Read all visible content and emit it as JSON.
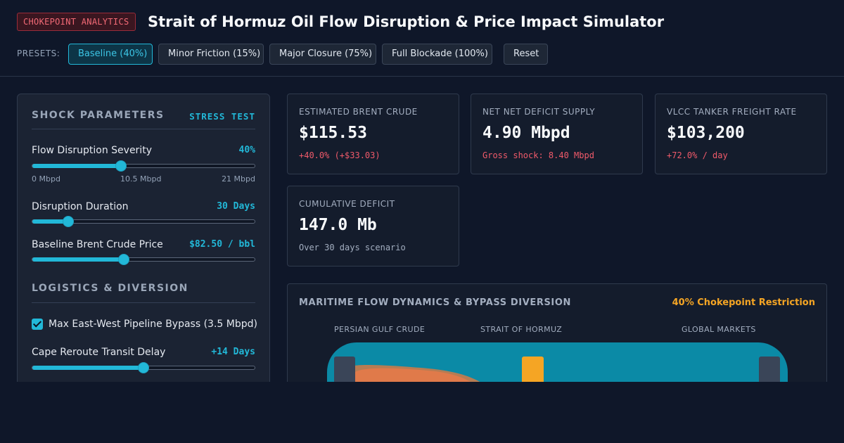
{
  "header": {
    "badge": "CHOKEPOINT ANALYTICS",
    "title": "Strait of Hormuz Oil Flow Disruption & Price Impact Simulator",
    "presets_label": "PRESETS:",
    "presets": [
      {
        "label": "Baseline (40%)",
        "active": true
      },
      {
        "label": "Minor Friction (15%)",
        "active": false
      },
      {
        "label": "Major Closure (75%)",
        "active": false
      },
      {
        "label": "Full Blockade (100%)",
        "active": false
      }
    ],
    "reset_label": "Reset"
  },
  "shock": {
    "title": "SHOCK PARAMETERS",
    "tag": "STRESS TEST",
    "severity": {
      "label": "Flow Disruption Severity",
      "value": "40%",
      "fraction": 0.4,
      "scale": [
        "0 Mbpd",
        "10.5 Mbpd",
        "21 Mbpd"
      ]
    },
    "duration": {
      "label": "Disruption Duration",
      "value": "30 Days",
      "fraction": 0.16
    },
    "price": {
      "label": "Baseline Brent Crude Price",
      "value": "$82.50 / bbl",
      "fraction": 0.41
    }
  },
  "logistics": {
    "title": "LOGISTICS & DIVERSION",
    "bypass": {
      "label": "Max East-West Pipeline Bypass (3.5 Mbpd)",
      "checked": true
    },
    "reroute": {
      "label": "Cape Reroute Transit Delay",
      "value": "+14 Days",
      "fraction": 0.5
    }
  },
  "cards": {
    "brent": {
      "label": "ESTIMATED BRENT CRUDE",
      "value": "$115.53",
      "sub": "+40.0% (+$33.03)"
    },
    "deficit": {
      "label": "NET NET DEFICIT SUPPLY",
      "value": "4.90 Mbpd",
      "sub": "Gross shock: 8.40 Mbpd"
    },
    "vlcc": {
      "label": "VLCC TANKER FREIGHT RATE",
      "value": "$103,200",
      "sub": "+72.0% / day"
    },
    "cumulative": {
      "label": "CUMULATIVE DEFICIT",
      "value": "147.0 Mb",
      "sub": "Over 30 days scenario"
    }
  },
  "flow": {
    "title": "MARITIME FLOW DYNAMICS & BYPASS DIVERSION",
    "tag": "40% Chokepoint Restriction",
    "columns": [
      "PERSIAN GULF CRUDE",
      "STRAIT OF HORMUZ",
      "GLOBAL MARKETS"
    ]
  },
  "colors": {
    "accent": "#22b8d8",
    "danger": "#f05a6a",
    "warning": "#f5a524",
    "background": "#0f1729"
  }
}
